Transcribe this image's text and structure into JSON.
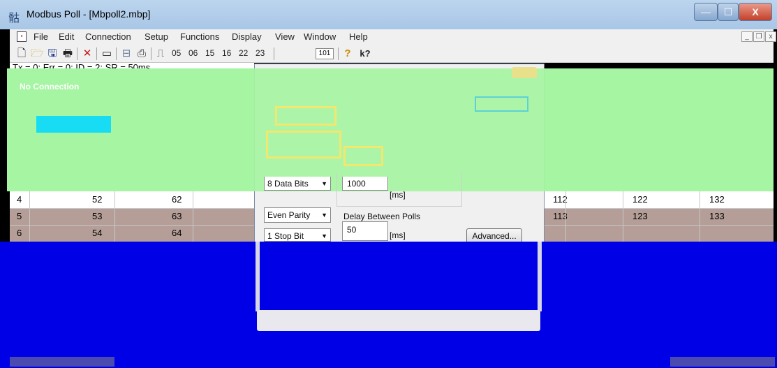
{
  "window": {
    "title": "Modbus Poll - [Mbpoll2.mbp]",
    "minimize_symbol": "—",
    "maximize_symbol": "☐",
    "close_symbol": "X"
  },
  "menu": [
    "File",
    "Edit",
    "Connection",
    "Setup",
    "Functions",
    "Display",
    "View",
    "Window",
    "Help"
  ],
  "mdi": {
    "minimize": "_",
    "restore": "❐",
    "close": "x"
  },
  "toolbar": {
    "function_codes": [
      "05",
      "06",
      "15",
      "16",
      "22",
      "23"
    ],
    "count_label": "101",
    "help_symbol": "?",
    "context_help_symbol": "k?"
  },
  "status_line": "Tx = 0: Err = 0: ID = 2:         SR = 50ms",
  "banner": "No Connection",
  "dialog": {
    "data_bits": "8 Data Bits",
    "parity": "Even Parity",
    "stop_bits": "1 Stop Bit",
    "response_timeout": "1000",
    "timeout_unit": "[ms]",
    "delay_label": "Delay Between Polls",
    "delay_value": "50",
    "delay_unit": "[ms]",
    "advanced_label": "Advanced..."
  },
  "table": {
    "rows": [
      {
        "index": "4",
        "c1": "52",
        "c2": "62",
        "c3": "112",
        "c4": "122",
        "c5": "132"
      },
      {
        "index": "5",
        "c1": "53",
        "c2": "63",
        "c3": "113",
        "c4": "123",
        "c5": "133"
      },
      {
        "index": "6",
        "c1": "54",
        "c2": "64",
        "c3": "",
        "c4": "",
        "c5": ""
      }
    ]
  },
  "colors": {
    "green_overlay": "#a6f5a2",
    "blue_area": "#0000e6",
    "row_highlight": "#b49e97",
    "selection_cyan": "#17dcf4"
  }
}
